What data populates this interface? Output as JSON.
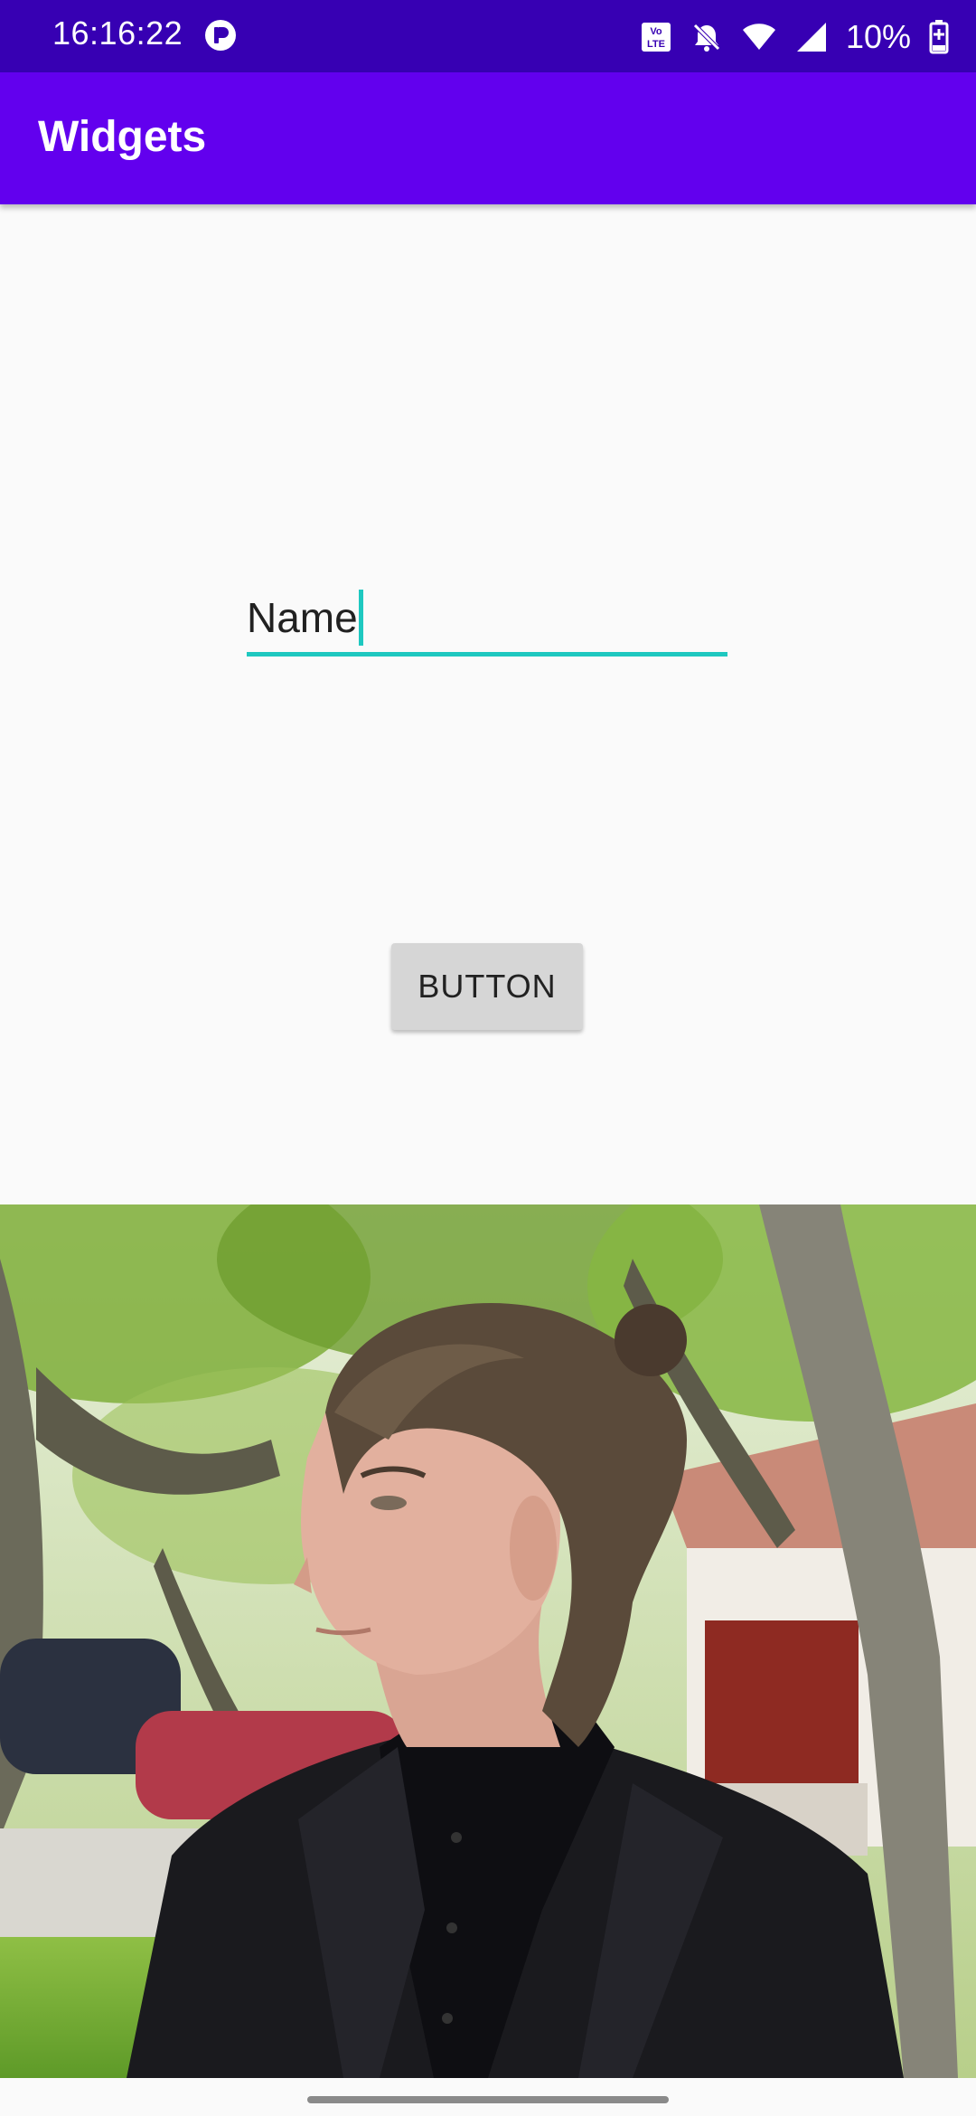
{
  "status_bar": {
    "time": "16:16:22",
    "battery_percent": "10%",
    "volte_label": "VoLTE",
    "icons": [
      "app-notification-icon",
      "volte-icon",
      "bell-off-icon",
      "wifi-icon",
      "cell-signal-icon",
      "battery-charging-icon"
    ]
  },
  "app_bar": {
    "title": "Widgets"
  },
  "name_field": {
    "value": "Name"
  },
  "button": {
    "label": "BUTTON"
  },
  "colors": {
    "status_bar": "#3700b3",
    "app_bar": "#6200ee",
    "accent": "#1ec8c0",
    "background": "#fafafa",
    "button": "#d6d6d6"
  }
}
